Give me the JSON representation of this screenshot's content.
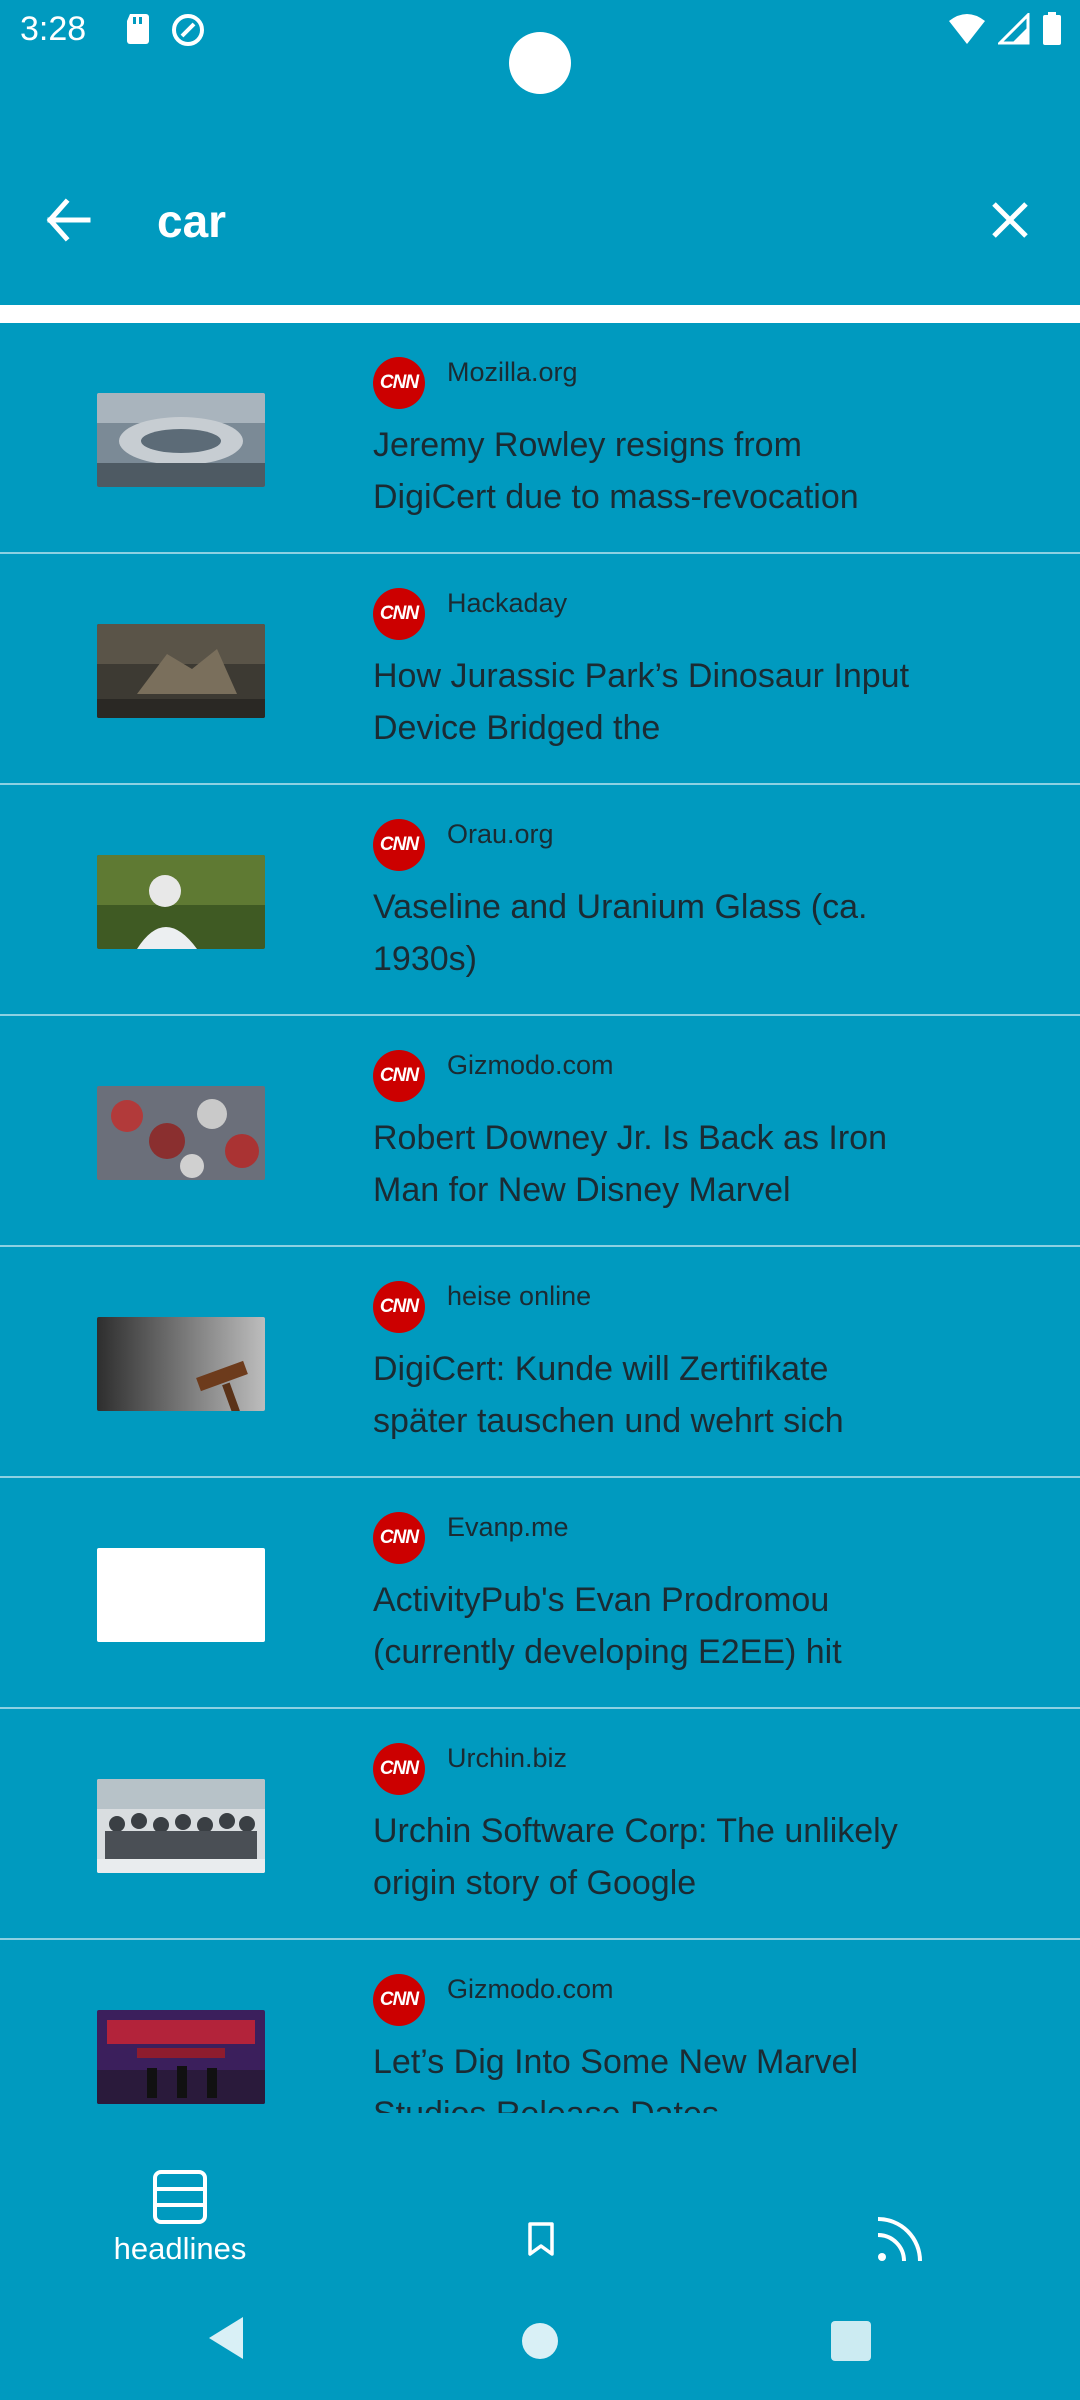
{
  "status_bar": {
    "time": "3:28",
    "left_icons": [
      "sd-card-icon",
      "sync-icon"
    ],
    "right_icons": [
      "wifi-icon",
      "signal-icon",
      "battery-icon"
    ]
  },
  "search": {
    "query": "car",
    "back_icon": "arrow-left-icon",
    "clear_icon": "close-icon"
  },
  "articles": [
    {
      "source": "Mozilla.org",
      "title": "Jeremy Rowley resigns from DigiCert due to mass-revocation",
      "logo": "CNN"
    },
    {
      "source": "Hackaday",
      "title": "How Jurassic Park’s Dinosaur Input Device Bridged the",
      "logo": "CNN"
    },
    {
      "source": "Orau.org",
      "title": "Vaseline and Uranium Glass (ca. 1930s)",
      "logo": "CNN"
    },
    {
      "source": "Gizmodo.com",
      "title": "Robert Downey Jr. Is Back as Iron Man for New Disney Marvel",
      "logo": "CNN"
    },
    {
      "source": "heise online",
      "title": "DigiCert: Kunde will Zertifikate später tauschen und wehrt sich",
      "logo": "CNN"
    },
    {
      "source": "Evanp.me",
      "title": "ActivityPub's Evan Prodromou (currently developing E2EE) hit",
      "logo": "CNN"
    },
    {
      "source": "Urchin.biz",
      "title": "Urchin Software Corp: The unlikely origin story of Google",
      "logo": "CNN"
    },
    {
      "source": "Gizmodo.com",
      "title": "Let’s Dig Into Some New Marvel Studios Release Dates",
      "logo": "CNN"
    }
  ],
  "bottom_nav": {
    "items": [
      {
        "label": "headlines",
        "icon": "headlines-icon",
        "active": true
      },
      {
        "label": "",
        "icon": "bookmark-icon",
        "active": false
      },
      {
        "label": "",
        "icon": "rss-feed-icon",
        "active": false
      }
    ]
  },
  "colors": {
    "background": "#009ABF",
    "text_dark": "#1b2b33",
    "logo_red": "#CC0000"
  }
}
